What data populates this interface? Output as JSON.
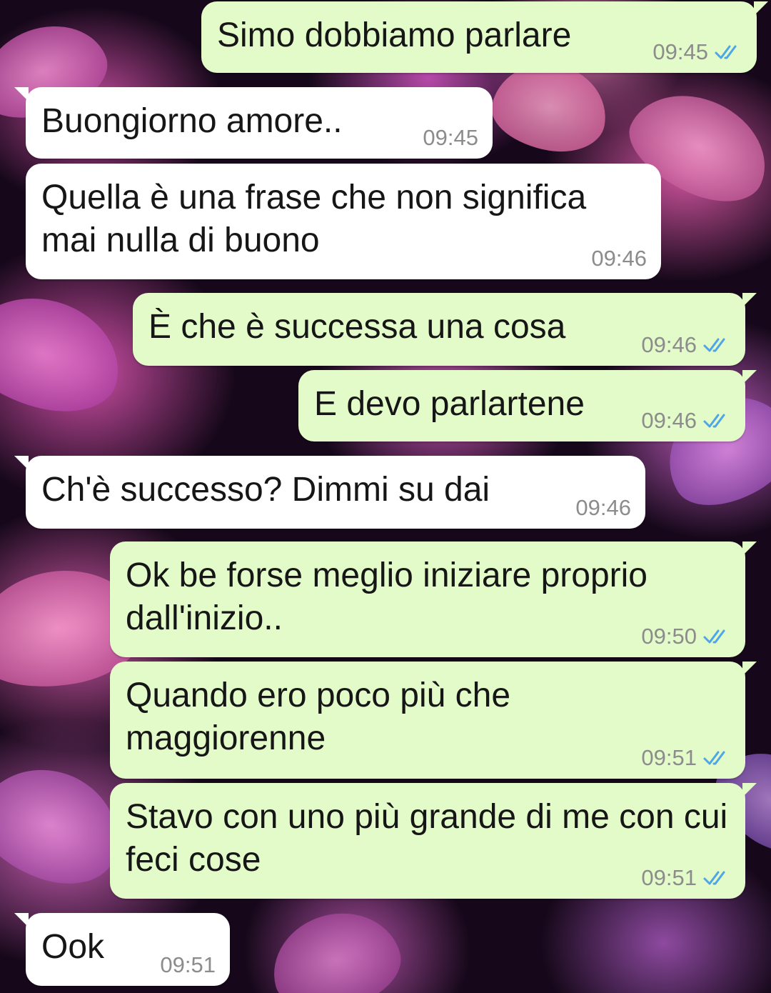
{
  "theme": {
    "outgoing_bubble": "#e2fbc8",
    "incoming_bubble": "#ffffff",
    "tick_color": "#4fa6e6"
  },
  "messages": [
    {
      "direction": "out",
      "text": "Simo dobbiamo parlare",
      "time": "09:45",
      "status": "read"
    },
    {
      "direction": "in",
      "text": "Buongiorno amore..",
      "time": "09:45"
    },
    {
      "direction": "in",
      "text": "Quella è una frase che non significa mai nulla di buono",
      "time": "09:46"
    },
    {
      "direction": "out",
      "text": "È che è successa una cosa",
      "time": "09:46",
      "status": "read"
    },
    {
      "direction": "out",
      "text": "E devo parlartene",
      "time": "09:46",
      "status": "read"
    },
    {
      "direction": "in",
      "text": "Ch'è successo? Dimmi su dai",
      "time": "09:46"
    },
    {
      "direction": "out",
      "text": "Ok be forse meglio iniziare proprio dall'inizio..",
      "time": "09:50",
      "status": "read"
    },
    {
      "direction": "out",
      "text": "Quando ero poco più che maggiorenne",
      "time": "09:51",
      "status": "read"
    },
    {
      "direction": "out",
      "text": "Stavo con uno più grande di me con cui feci cose",
      "time": "09:51",
      "status": "read"
    },
    {
      "direction": "in",
      "text": "Ook",
      "time": "09:51"
    }
  ]
}
